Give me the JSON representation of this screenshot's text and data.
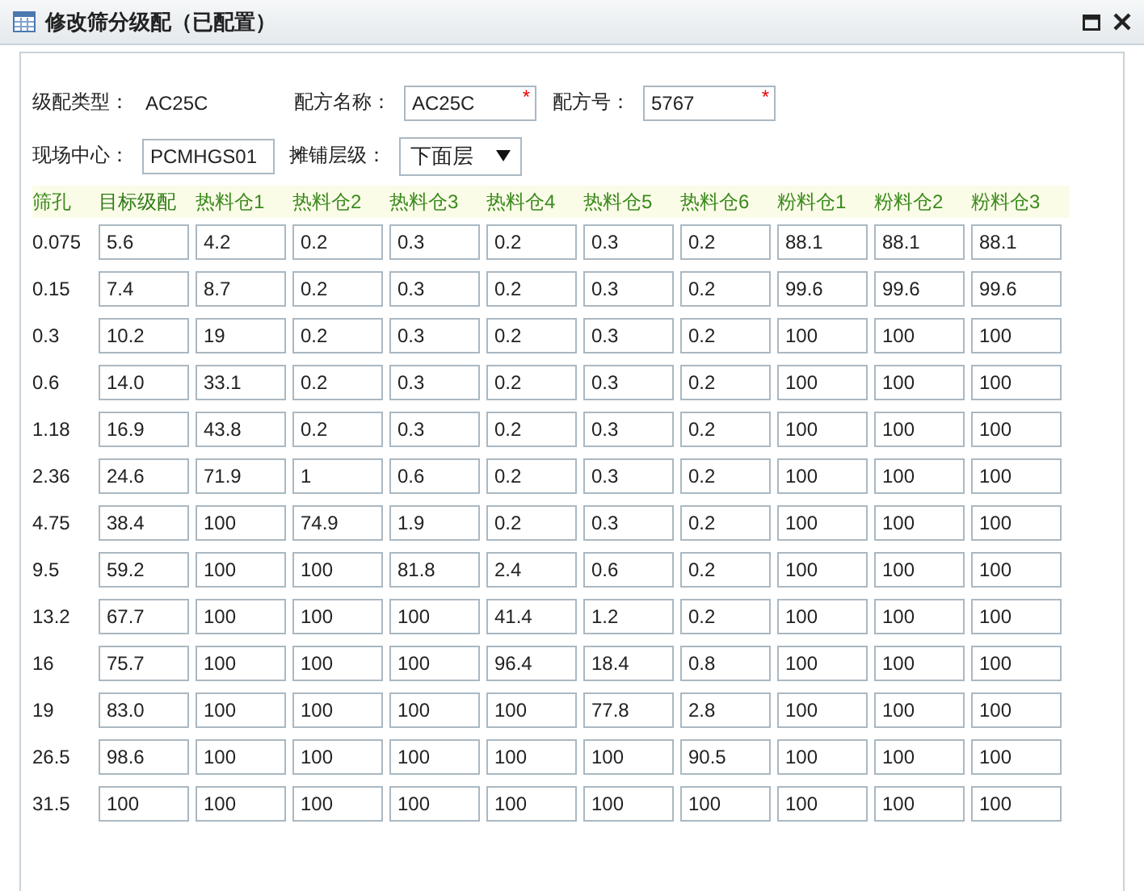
{
  "window": {
    "title": "修改筛分级配（已配置）"
  },
  "form": {
    "grade_type": {
      "label": "级配类型：",
      "value": "AC25C"
    },
    "recipe_name": {
      "label": "配方名称：",
      "value": "AC25C",
      "required_mark": "*"
    },
    "recipe_no": {
      "label": "配方号：",
      "value": "5767",
      "required_mark": "*"
    },
    "site": {
      "label": "现场中心：",
      "value": "PCMHGS01"
    },
    "layer": {
      "label": "摊铺层级：",
      "value": "下面层"
    }
  },
  "table": {
    "columns": [
      "筛孔",
      "目标级配",
      "热料仓1",
      "热料仓2",
      "热料仓3",
      "热料仓4",
      "热料仓5",
      "热料仓6",
      "粉料仓1",
      "粉料仓2",
      "粉料仓3"
    ],
    "rows": [
      {
        "sieve": "0.075",
        "values": [
          "5.6",
          "4.2",
          "0.2",
          "0.3",
          "0.2",
          "0.3",
          "0.2",
          "88.1",
          "88.1",
          "88.1"
        ]
      },
      {
        "sieve": "0.15",
        "values": [
          "7.4",
          "8.7",
          "0.2",
          "0.3",
          "0.2",
          "0.3",
          "0.2",
          "99.6",
          "99.6",
          "99.6"
        ]
      },
      {
        "sieve": "0.3",
        "values": [
          "10.2",
          "19",
          "0.2",
          "0.3",
          "0.2",
          "0.3",
          "0.2",
          "100",
          "100",
          "100"
        ]
      },
      {
        "sieve": "0.6",
        "values": [
          "14.0",
          "33.1",
          "0.2",
          "0.3",
          "0.2",
          "0.3",
          "0.2",
          "100",
          "100",
          "100"
        ]
      },
      {
        "sieve": "1.18",
        "values": [
          "16.9",
          "43.8",
          "0.2",
          "0.3",
          "0.2",
          "0.3",
          "0.2",
          "100",
          "100",
          "100"
        ]
      },
      {
        "sieve": "2.36",
        "values": [
          "24.6",
          "71.9",
          "1",
          "0.6",
          "0.2",
          "0.3",
          "0.2",
          "100",
          "100",
          "100"
        ]
      },
      {
        "sieve": "4.75",
        "values": [
          "38.4",
          "100",
          "74.9",
          "1.9",
          "0.2",
          "0.3",
          "0.2",
          "100",
          "100",
          "100"
        ]
      },
      {
        "sieve": "9.5",
        "values": [
          "59.2",
          "100",
          "100",
          "81.8",
          "2.4",
          "0.6",
          "0.2",
          "100",
          "100",
          "100"
        ]
      },
      {
        "sieve": "13.2",
        "values": [
          "67.7",
          "100",
          "100",
          "100",
          "41.4",
          "1.2",
          "0.2",
          "100",
          "100",
          "100"
        ]
      },
      {
        "sieve": "16",
        "values": [
          "75.7",
          "100",
          "100",
          "100",
          "96.4",
          "18.4",
          "0.8",
          "100",
          "100",
          "100"
        ]
      },
      {
        "sieve": "19",
        "values": [
          "83.0",
          "100",
          "100",
          "100",
          "100",
          "77.8",
          "2.8",
          "100",
          "100",
          "100"
        ]
      },
      {
        "sieve": "26.5",
        "values": [
          "98.6",
          "100",
          "100",
          "100",
          "100",
          "100",
          "90.5",
          "100",
          "100",
          "100"
        ]
      },
      {
        "sieve": "31.5",
        "values": [
          "100",
          "100",
          "100",
          "100",
          "100",
          "100",
          "100",
          "100",
          "100",
          "100"
        ]
      }
    ]
  }
}
